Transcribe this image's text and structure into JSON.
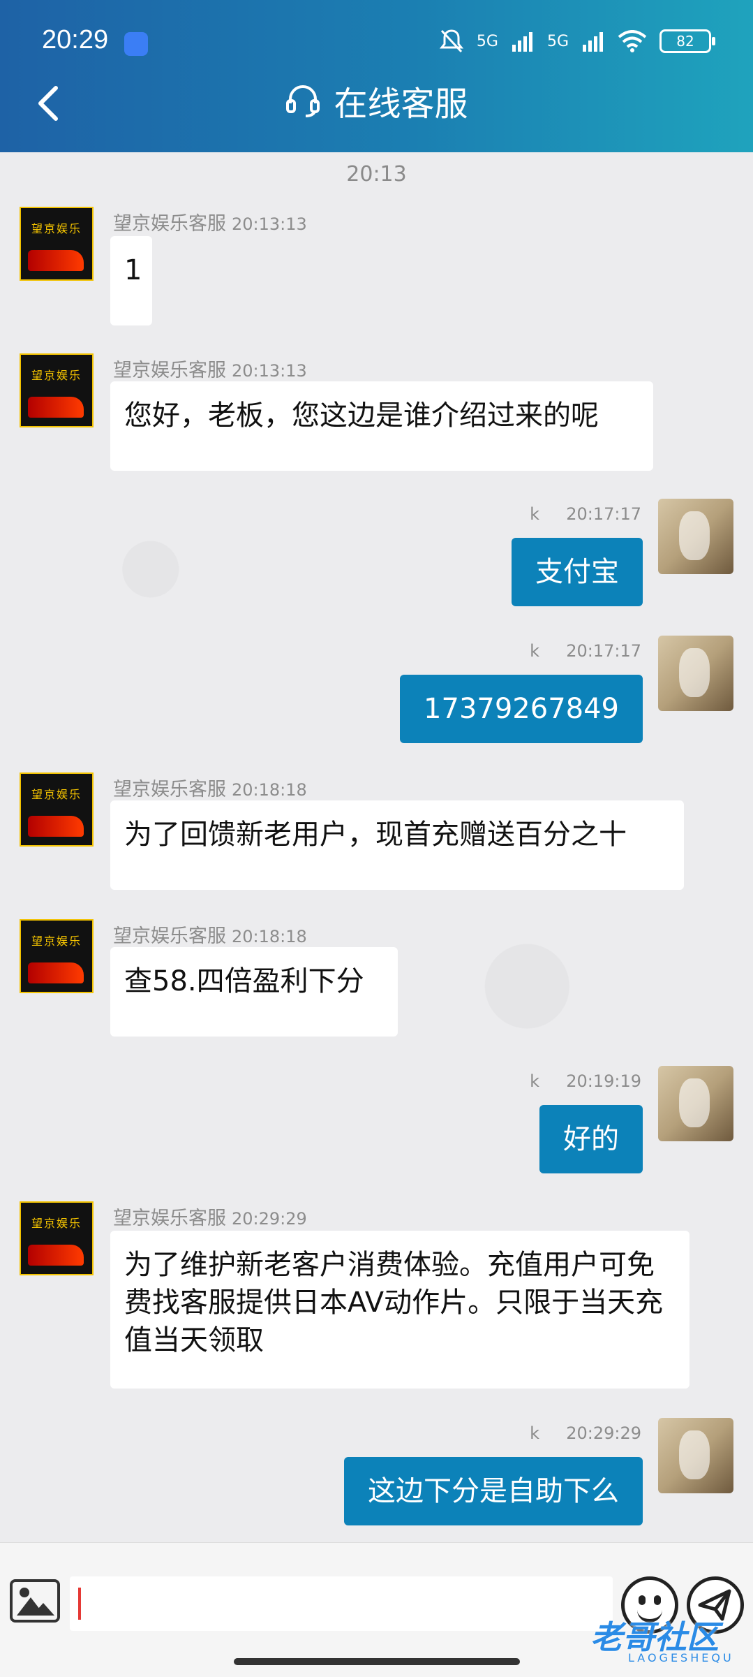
{
  "status_bar": {
    "time": "20:29",
    "signal1": "5G",
    "signal2": "5G",
    "battery": "82"
  },
  "header": {
    "title": "在线客服"
  },
  "chat": {
    "time_divider": "20:13",
    "messages": [
      {
        "side": "left",
        "sender": "望京娱乐客服",
        "time": "20:13:13",
        "text": "1"
      },
      {
        "side": "left",
        "sender": "望京娱乐客服",
        "time": "20:13:13",
        "text": "您好，老板，您这边是谁介绍过来的呢"
      },
      {
        "side": "right",
        "sender": "k",
        "time": "20:17:17",
        "text": "支付宝"
      },
      {
        "side": "right",
        "sender": "k",
        "time": "20:17:17",
        "text": "17379267849"
      },
      {
        "side": "left",
        "sender": "望京娱乐客服",
        "time": "20:18:18",
        "text": "为了回馈新老用户，现首充赠送百分之十"
      },
      {
        "side": "left",
        "sender": "望京娱乐客服",
        "time": "20:18:18",
        "text": "查58.四倍盈利下分"
      },
      {
        "side": "right",
        "sender": "k",
        "time": "20:19:19",
        "text": "好的"
      },
      {
        "side": "left",
        "sender": "望京娱乐客服",
        "time": "20:29:29",
        "text": "为了维护新老客户消费体验。充值用户可免费找客服提供日本AV动作片。只限于当天充值当天领取"
      },
      {
        "side": "right",
        "sender": "k",
        "time": "20:29:29",
        "text": "这边下分是自助下么"
      }
    ],
    "avatar_logo_text": "望京娱乐"
  },
  "input": {
    "value": "",
    "placeholder": ""
  },
  "watermark": {
    "text": "老哥社区",
    "sub": "LAOGESHEQU"
  },
  "colors": {
    "header_start": "#1e62a6",
    "header_end": "#1fa3bd",
    "bubble_right": "#0c82b9",
    "bubble_left": "#ffffff",
    "background": "#ececee"
  }
}
